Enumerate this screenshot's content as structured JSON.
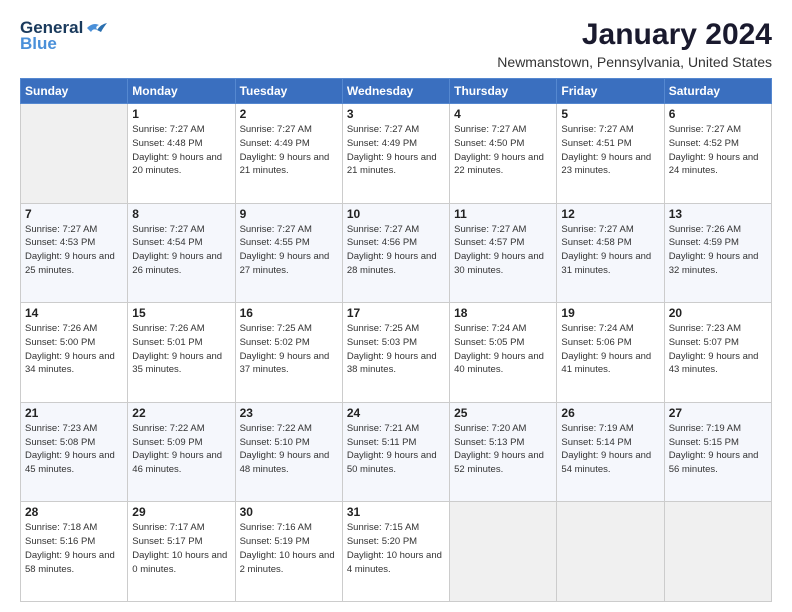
{
  "header": {
    "logo_line1": "General",
    "logo_line2": "Blue",
    "title": "January 2024",
    "subtitle": "Newmanstown, Pennsylvania, United States"
  },
  "calendar": {
    "days_of_week": [
      "Sunday",
      "Monday",
      "Tuesday",
      "Wednesday",
      "Thursday",
      "Friday",
      "Saturday"
    ],
    "weeks": [
      [
        {
          "day": "",
          "sunrise": "",
          "sunset": "",
          "daylight": ""
        },
        {
          "day": "1",
          "sunrise": "Sunrise: 7:27 AM",
          "sunset": "Sunset: 4:48 PM",
          "daylight": "Daylight: 9 hours and 20 minutes."
        },
        {
          "day": "2",
          "sunrise": "Sunrise: 7:27 AM",
          "sunset": "Sunset: 4:49 PM",
          "daylight": "Daylight: 9 hours and 21 minutes."
        },
        {
          "day": "3",
          "sunrise": "Sunrise: 7:27 AM",
          "sunset": "Sunset: 4:49 PM",
          "daylight": "Daylight: 9 hours and 21 minutes."
        },
        {
          "day": "4",
          "sunrise": "Sunrise: 7:27 AM",
          "sunset": "Sunset: 4:50 PM",
          "daylight": "Daylight: 9 hours and 22 minutes."
        },
        {
          "day": "5",
          "sunrise": "Sunrise: 7:27 AM",
          "sunset": "Sunset: 4:51 PM",
          "daylight": "Daylight: 9 hours and 23 minutes."
        },
        {
          "day": "6",
          "sunrise": "Sunrise: 7:27 AM",
          "sunset": "Sunset: 4:52 PM",
          "daylight": "Daylight: 9 hours and 24 minutes."
        }
      ],
      [
        {
          "day": "7",
          "sunrise": "Sunrise: 7:27 AM",
          "sunset": "Sunset: 4:53 PM",
          "daylight": "Daylight: 9 hours and 25 minutes."
        },
        {
          "day": "8",
          "sunrise": "Sunrise: 7:27 AM",
          "sunset": "Sunset: 4:54 PM",
          "daylight": "Daylight: 9 hours and 26 minutes."
        },
        {
          "day": "9",
          "sunrise": "Sunrise: 7:27 AM",
          "sunset": "Sunset: 4:55 PM",
          "daylight": "Daylight: 9 hours and 27 minutes."
        },
        {
          "day": "10",
          "sunrise": "Sunrise: 7:27 AM",
          "sunset": "Sunset: 4:56 PM",
          "daylight": "Daylight: 9 hours and 28 minutes."
        },
        {
          "day": "11",
          "sunrise": "Sunrise: 7:27 AM",
          "sunset": "Sunset: 4:57 PM",
          "daylight": "Daylight: 9 hours and 30 minutes."
        },
        {
          "day": "12",
          "sunrise": "Sunrise: 7:27 AM",
          "sunset": "Sunset: 4:58 PM",
          "daylight": "Daylight: 9 hours and 31 minutes."
        },
        {
          "day": "13",
          "sunrise": "Sunrise: 7:26 AM",
          "sunset": "Sunset: 4:59 PM",
          "daylight": "Daylight: 9 hours and 32 minutes."
        }
      ],
      [
        {
          "day": "14",
          "sunrise": "Sunrise: 7:26 AM",
          "sunset": "Sunset: 5:00 PM",
          "daylight": "Daylight: 9 hours and 34 minutes."
        },
        {
          "day": "15",
          "sunrise": "Sunrise: 7:26 AM",
          "sunset": "Sunset: 5:01 PM",
          "daylight": "Daylight: 9 hours and 35 minutes."
        },
        {
          "day": "16",
          "sunrise": "Sunrise: 7:25 AM",
          "sunset": "Sunset: 5:02 PM",
          "daylight": "Daylight: 9 hours and 37 minutes."
        },
        {
          "day": "17",
          "sunrise": "Sunrise: 7:25 AM",
          "sunset": "Sunset: 5:03 PM",
          "daylight": "Daylight: 9 hours and 38 minutes."
        },
        {
          "day": "18",
          "sunrise": "Sunrise: 7:24 AM",
          "sunset": "Sunset: 5:05 PM",
          "daylight": "Daylight: 9 hours and 40 minutes."
        },
        {
          "day": "19",
          "sunrise": "Sunrise: 7:24 AM",
          "sunset": "Sunset: 5:06 PM",
          "daylight": "Daylight: 9 hours and 41 minutes."
        },
        {
          "day": "20",
          "sunrise": "Sunrise: 7:23 AM",
          "sunset": "Sunset: 5:07 PM",
          "daylight": "Daylight: 9 hours and 43 minutes."
        }
      ],
      [
        {
          "day": "21",
          "sunrise": "Sunrise: 7:23 AM",
          "sunset": "Sunset: 5:08 PM",
          "daylight": "Daylight: 9 hours and 45 minutes."
        },
        {
          "day": "22",
          "sunrise": "Sunrise: 7:22 AM",
          "sunset": "Sunset: 5:09 PM",
          "daylight": "Daylight: 9 hours and 46 minutes."
        },
        {
          "day": "23",
          "sunrise": "Sunrise: 7:22 AM",
          "sunset": "Sunset: 5:10 PM",
          "daylight": "Daylight: 9 hours and 48 minutes."
        },
        {
          "day": "24",
          "sunrise": "Sunrise: 7:21 AM",
          "sunset": "Sunset: 5:11 PM",
          "daylight": "Daylight: 9 hours and 50 minutes."
        },
        {
          "day": "25",
          "sunrise": "Sunrise: 7:20 AM",
          "sunset": "Sunset: 5:13 PM",
          "daylight": "Daylight: 9 hours and 52 minutes."
        },
        {
          "day": "26",
          "sunrise": "Sunrise: 7:19 AM",
          "sunset": "Sunset: 5:14 PM",
          "daylight": "Daylight: 9 hours and 54 minutes."
        },
        {
          "day": "27",
          "sunrise": "Sunrise: 7:19 AM",
          "sunset": "Sunset: 5:15 PM",
          "daylight": "Daylight: 9 hours and 56 minutes."
        }
      ],
      [
        {
          "day": "28",
          "sunrise": "Sunrise: 7:18 AM",
          "sunset": "Sunset: 5:16 PM",
          "daylight": "Daylight: 9 hours and 58 minutes."
        },
        {
          "day": "29",
          "sunrise": "Sunrise: 7:17 AM",
          "sunset": "Sunset: 5:17 PM",
          "daylight": "Daylight: 10 hours and 0 minutes."
        },
        {
          "day": "30",
          "sunrise": "Sunrise: 7:16 AM",
          "sunset": "Sunset: 5:19 PM",
          "daylight": "Daylight: 10 hours and 2 minutes."
        },
        {
          "day": "31",
          "sunrise": "Sunrise: 7:15 AM",
          "sunset": "Sunset: 5:20 PM",
          "daylight": "Daylight: 10 hours and 4 minutes."
        },
        {
          "day": "",
          "sunrise": "",
          "sunset": "",
          "daylight": ""
        },
        {
          "day": "",
          "sunrise": "",
          "sunset": "",
          "daylight": ""
        },
        {
          "day": "",
          "sunrise": "",
          "sunset": "",
          "daylight": ""
        }
      ]
    ]
  }
}
